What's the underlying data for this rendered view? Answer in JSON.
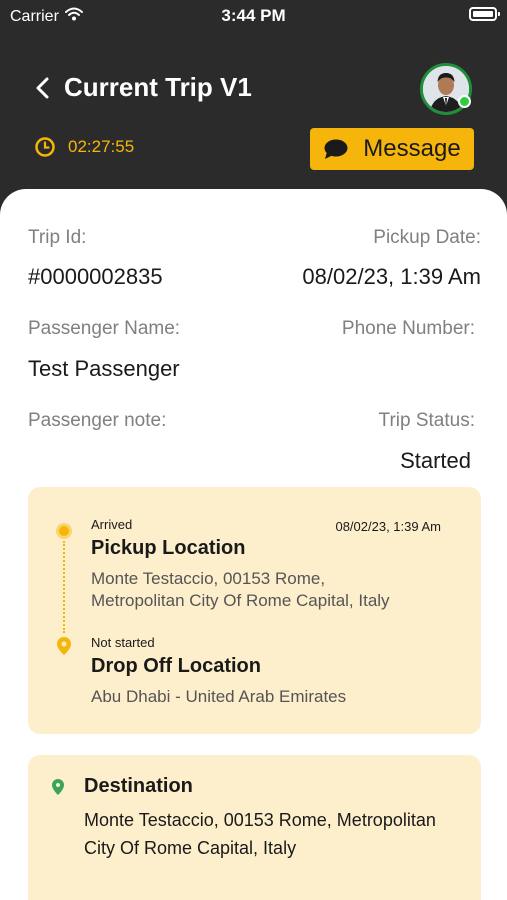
{
  "status_bar": {
    "carrier": "Carrier",
    "time": "3:44 PM"
  },
  "header": {
    "title": "Current Trip V1",
    "timer": "02:27:55",
    "message_label": "Message"
  },
  "trip": {
    "trip_id_label": "Trip Id:",
    "trip_id": "#0000002835",
    "pickup_date_label": "Pickup Date:",
    "pickup_date": "08/02/23, 1:39 Am",
    "passenger_name_label": "Passenger Name:",
    "passenger_name": "Test Passenger",
    "phone_label": "Phone Number:",
    "passenger_note_label": "Passenger note:",
    "status_label": "Trip Status:",
    "status": "Started"
  },
  "route": {
    "pickup": {
      "status": "Arrived",
      "time": "08/02/23, 1:39 Am",
      "title": "Pickup Location",
      "address_line1": "Monte Testaccio, 00153 Rome,",
      "address_line2": "Metropolitan City Of Rome Capital, Italy"
    },
    "dropoff": {
      "status": "Not started",
      "title": "Drop Off Location",
      "address": "Abu Dhabi - United Arab Emirates"
    }
  },
  "destination": {
    "title": "Destination",
    "address_line1": "Monte Testaccio, 00153 Rome, Metropolitan",
    "address_line2": "City Of Rome Capital, Italy"
  },
  "colors": {
    "accent": "#f5b50a",
    "header_bg": "#2b2b2b",
    "card_bg": "#fdefcc",
    "online": "#2ecc40"
  }
}
